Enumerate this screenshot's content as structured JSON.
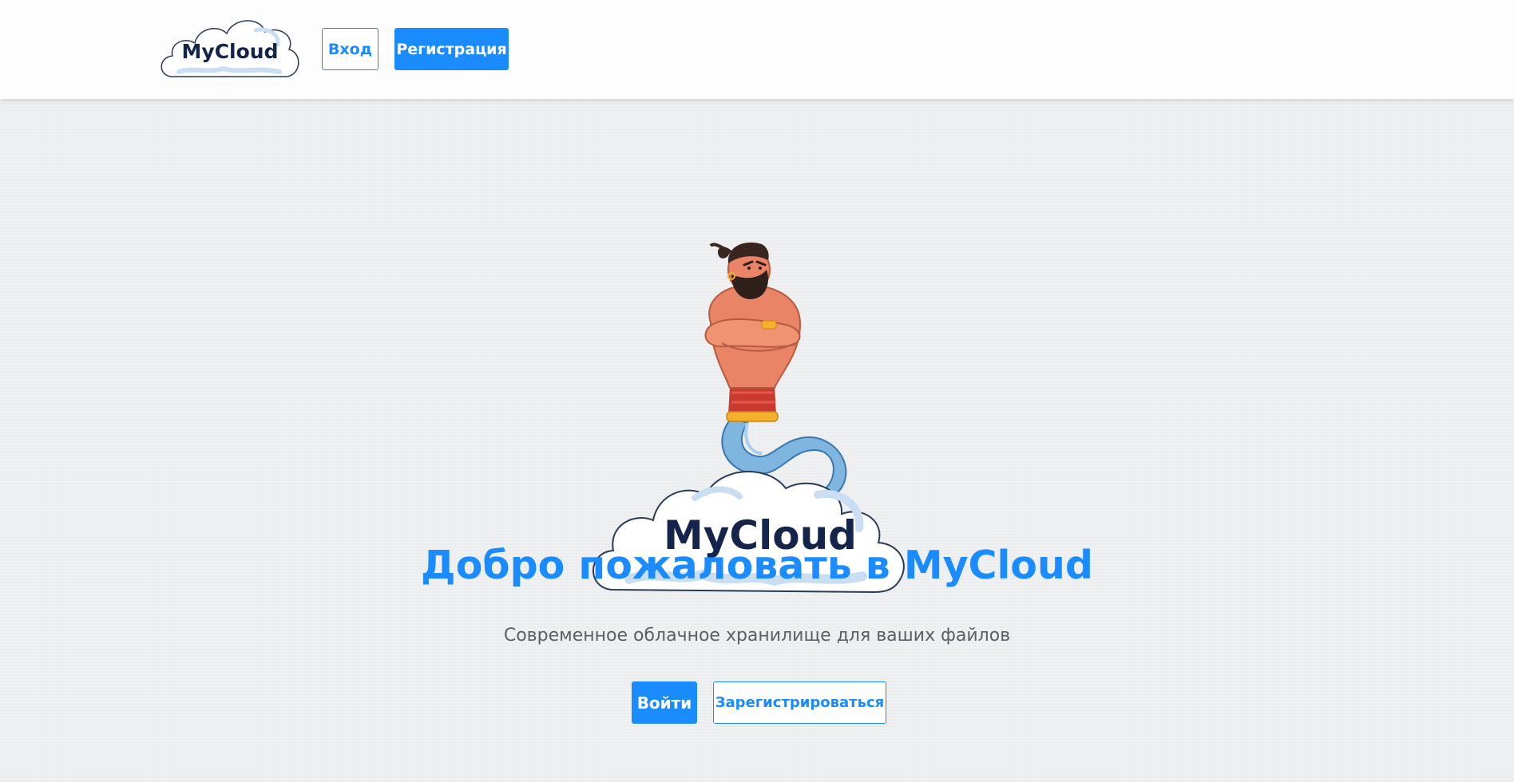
{
  "header": {
    "logo_text": "MyCloud",
    "login_label": "Вход",
    "register_label": "Регистрация"
  },
  "hero": {
    "logo_text": "MyCloud",
    "title": "Добро пожаловать в MyCloud",
    "subtitle": "Современное облачное хранилище для ваших файлов",
    "enter_label": "Войти",
    "signup_label": "Зарегистрироваться"
  },
  "colors": {
    "accent": "#1a8cff",
    "logo_text": "#14244a",
    "background": "#eef0f2",
    "header_bg": "#fdfdfd"
  },
  "icons": [
    "mycloud-logo-icon",
    "genie-illustration"
  ]
}
